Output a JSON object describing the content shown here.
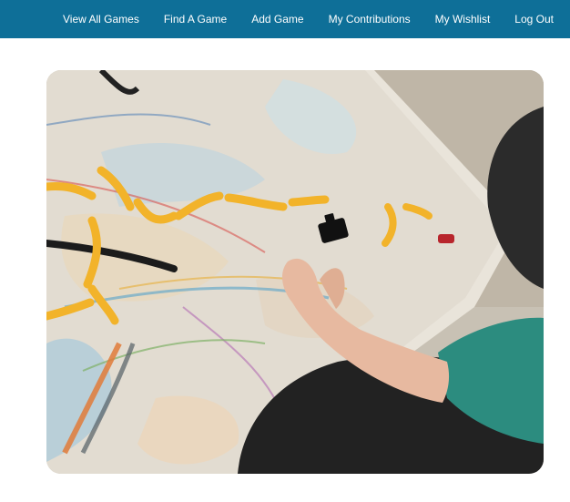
{
  "nav": {
    "links": [
      {
        "label": "View All Games"
      },
      {
        "label": "Find A Game"
      },
      {
        "label": "Add Game"
      },
      {
        "label": "My Contributions"
      },
      {
        "label": "My Wishlist"
      },
      {
        "label": "Log Out"
      }
    ]
  },
  "hero": {
    "image_name": "hero-board-game-photo"
  },
  "colors": {
    "navbar": "#0e6f98",
    "nav_text": "#ffffff",
    "page_background": "#ffffff"
  }
}
